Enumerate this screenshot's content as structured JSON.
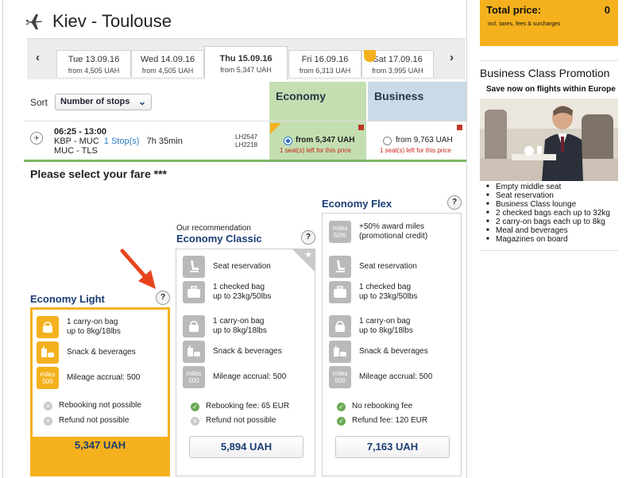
{
  "route": {
    "title": "Kiev - Toulouse"
  },
  "dates": {
    "prev_label": "‹",
    "next_label": "›",
    "tabs": [
      {
        "date": "Tue 13.09.16",
        "price": "from  4,505 UAH"
      },
      {
        "date": "Wed 14.09.16",
        "price": "from  4,505 UAH"
      },
      {
        "date": "Thu 15.09.16",
        "price": "from  5,347 UAH"
      },
      {
        "date": "Fri 16.09.16",
        "price": "from  6,313 UAH"
      },
      {
        "date": "Sat 17.09.16",
        "price": "from  3,995 UAH"
      }
    ]
  },
  "sort": {
    "label": "Sort",
    "selected": "Number of stops"
  },
  "cabins": {
    "economy": "Economy",
    "business": "Business"
  },
  "flight": {
    "time": "06:25 - 13:00",
    "leg1_route": "KBP - MUC",
    "stops": "1 Stop(s)",
    "duration": "7h 35min",
    "leg2_route": "MUC - TLS",
    "flight_no_1": "LH2547",
    "flight_no_2": "LH2218",
    "economy_price": "from 5,347 UAH",
    "economy_seats": "1 seat(s) left for this price",
    "business_price": "from 9,763 UAH",
    "business_seats": "1 seat(s) left for this price"
  },
  "fares": {
    "heading": "Please select your fare ***",
    "help_label": "?",
    "light": {
      "name": "Economy Light",
      "carry_on": "1 carry-on bag\nup to 8kg/18lbs",
      "snack": "Snack & beverages",
      "miles_icon_top": "miles",
      "miles_icon_bottom": "500",
      "mileage": "Mileage accrual: 500",
      "rebooking": "Rebooking not possible",
      "refund": "Refund not possible",
      "price": "5,347 UAH"
    },
    "classic": {
      "recommendation": "Our recommendation",
      "name": "Economy Classic",
      "seat": "Seat reservation",
      "checked": "1 checked bag\nup to 23kg/50lbs",
      "carry_on": "1 carry-on bag\nup to 8kg/18lbs",
      "snack": "Snack & beverages",
      "miles_icon_top": "miles",
      "miles_icon_bottom": "500",
      "mileage": "Mileage accrual: 500",
      "rebooking": "Rebooking fee: 65 EUR",
      "refund": "Refund not possible",
      "price": "5,894 UAH"
    },
    "flex": {
      "name": "Economy Flex",
      "award_icon_top": "miles",
      "award_icon_bottom": "50%",
      "award": "+50% award miles\n(promotional credit)",
      "seat": "Seat reservation",
      "checked": "1 checked bag\nup to 23kg/50lbs",
      "carry_on": "1 carry-on bag\nup to 8kg/18lbs",
      "snack": "Snack & beverages",
      "miles_icon_top": "miles",
      "miles_icon_bottom": "500",
      "mileage": "Mileage accrual: 500",
      "rebooking": "No rebooking fee",
      "refund": "Refund fee: 120 EUR",
      "price": "7,163 UAH"
    }
  },
  "sidebar": {
    "total_label": "Total price:",
    "total_value": "0",
    "total_note": "incl. taxes, fees & surcharges",
    "promo_title": "Business Class Promotion",
    "promo_sub": "Save now on flights within Europe",
    "promo_items": [
      "Empty middle seat",
      "Seat reservation",
      "Business Class lounge",
      "2 checked bags each up to 32kg",
      "2 carry-on bags each up to 8kg",
      "Meal and beverages",
      "Magazines on board"
    ]
  },
  "colors": {
    "brand_yellow": "#f5b11d",
    "economy_green": "#c3dfb1",
    "business_blue": "#c8dbe6",
    "link_blue": "#1b3d75",
    "alert_red": "#c8231b"
  },
  "icons": {
    "plane": "plane-icon",
    "flight_info": "flight-info-icon",
    "seat": "seat-icon",
    "checked_bag": "suitcase-icon",
    "carry_on": "handbag-icon",
    "snack": "cup-food-icon",
    "miles": "miles-badge-icon",
    "not_included": "x-circle-icon",
    "included": "check-circle-icon",
    "star": "star-icon",
    "arrow": "red-arrow-annotation"
  }
}
